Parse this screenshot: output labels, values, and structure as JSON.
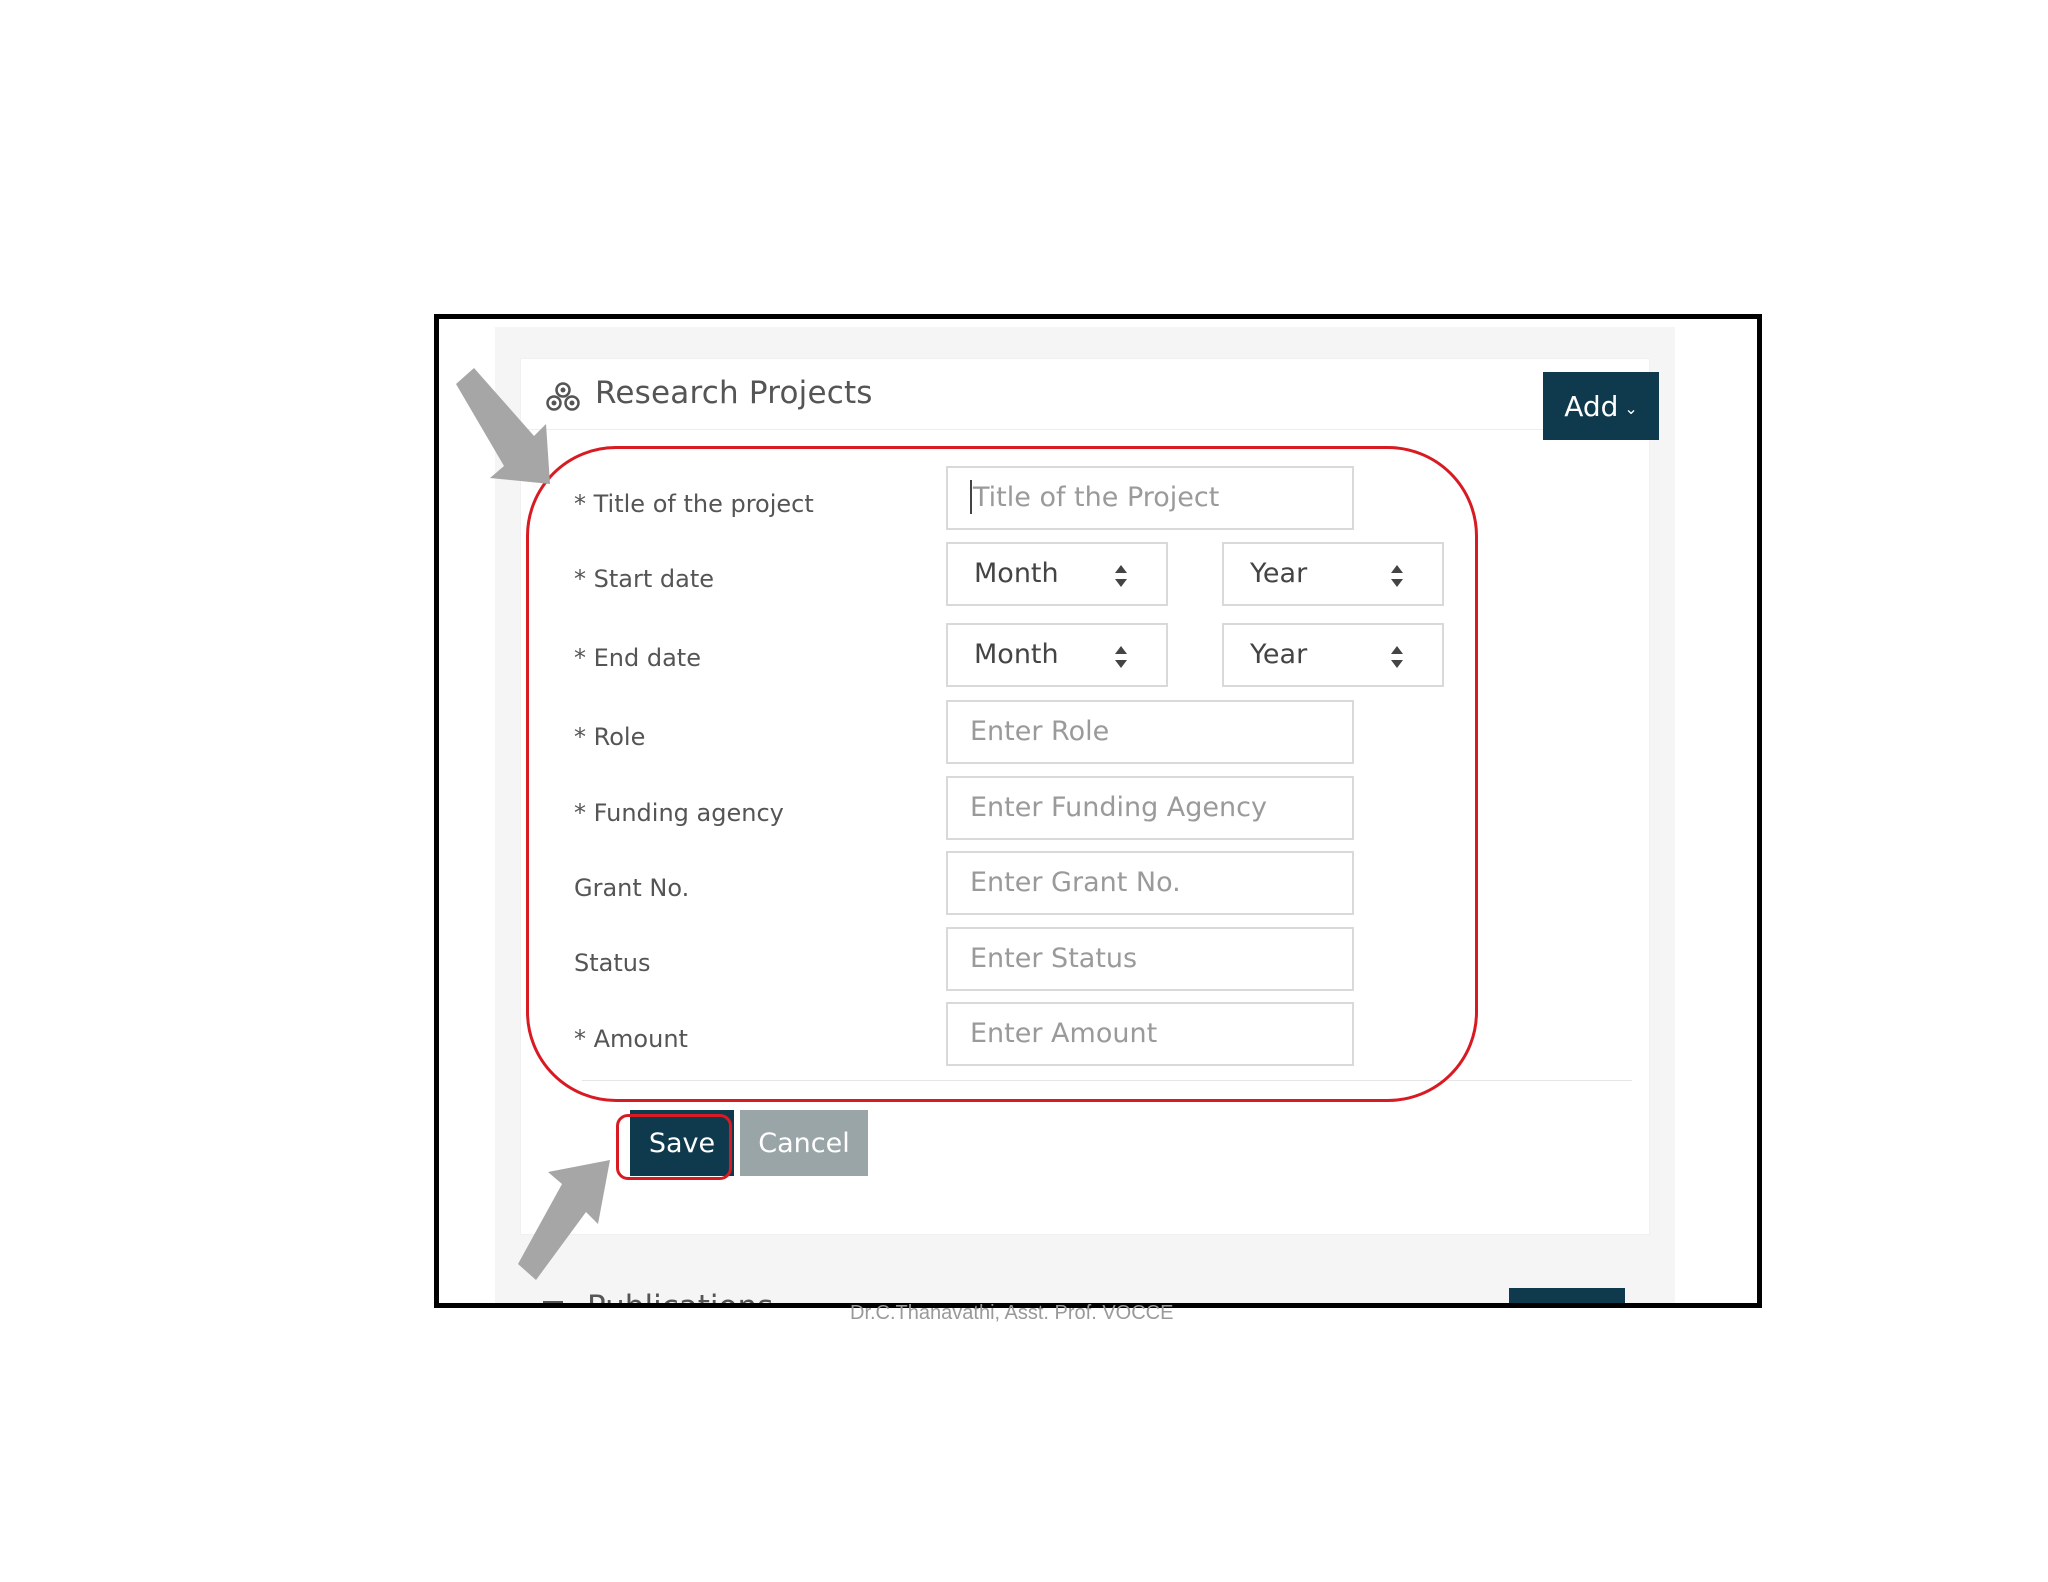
{
  "header": {
    "title": "Research Projects",
    "add_label": "Add"
  },
  "form": {
    "fields": [
      {
        "label": "* Title of the project",
        "placeholder": "Title of the Project"
      },
      {
        "label": "* Start date",
        "month": "Month",
        "year": "Year"
      },
      {
        "label": "* End date",
        "month": "Month",
        "year": "Year"
      },
      {
        "label": "* Role",
        "placeholder": "Enter Role"
      },
      {
        "label": "* Funding agency",
        "placeholder": "Enter Funding Agency"
      },
      {
        "label": "Grant No.",
        "placeholder": "Enter Grant No."
      },
      {
        "label": "Status",
        "placeholder": "Enter Status"
      },
      {
        "label": "* Amount",
        "placeholder": "Enter Amount"
      }
    ],
    "save_label": "Save",
    "cancel_label": "Cancel"
  },
  "next_section": {
    "title": "Publications"
  },
  "footer": {
    "credit": "Dr.C.Thanavathi, Asst. Prof. VOCCE"
  },
  "colors": {
    "primary": "#0f3a4e",
    "secondary": "#9aa5a7",
    "annotation": "#d81b23",
    "arrow": "#a6a6a6"
  }
}
